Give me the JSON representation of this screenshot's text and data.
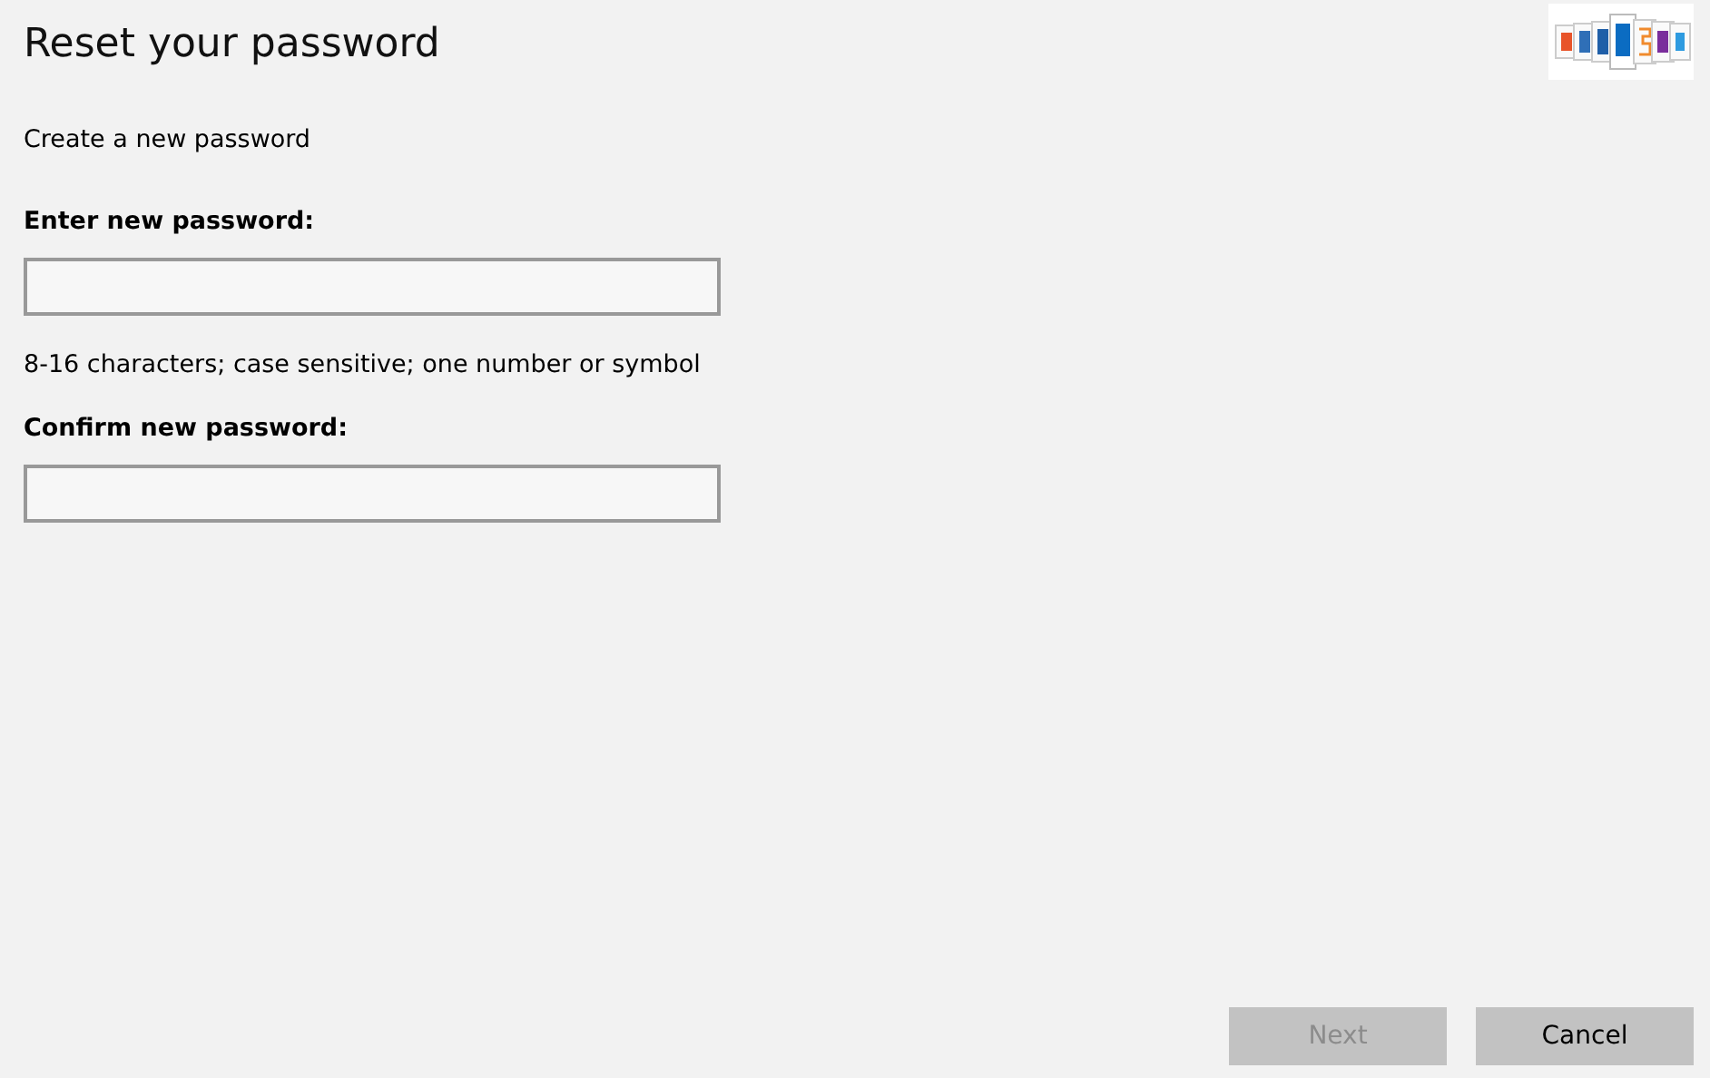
{
  "title": "Reset your password",
  "subtitle": "Create a new password",
  "fields": [
    {
      "label": "Enter new password:",
      "hint": "8-16 characters; case sensitive; one number or symbol"
    },
    {
      "label": "Confirm new password:"
    }
  ],
  "buttons": [
    {
      "label": "Next",
      "disabled": true
    },
    {
      "label": "Cancel",
      "disabled": false
    }
  ]
}
